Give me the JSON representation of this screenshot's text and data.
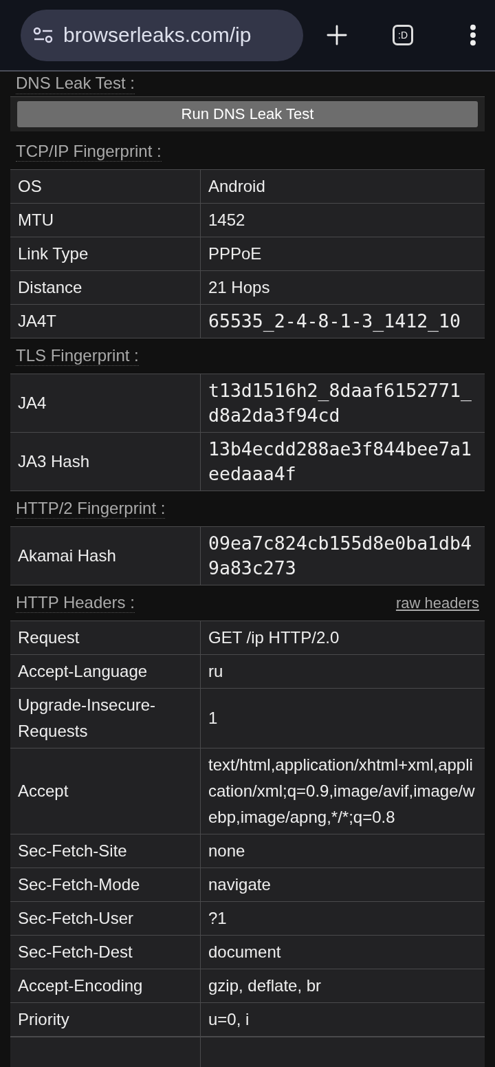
{
  "browser": {
    "url": "browserleaks.com/ip",
    "tab_count": ":D"
  },
  "sections": [
    {
      "title": "DNS Leak Test :",
      "button": "Run DNS Leak Test"
    },
    {
      "title": "TCP/IP Fingerprint :",
      "rows": [
        {
          "key": "OS",
          "value": "Android",
          "kind": "text"
        },
        {
          "key": "MTU",
          "value": "1452",
          "kind": "text"
        },
        {
          "key": "Link Type",
          "value": "PPPoE",
          "kind": "text"
        },
        {
          "key": "Distance",
          "value": "21 Hops",
          "kind": "text"
        },
        {
          "key": "JA4T",
          "value": "65535_2-4-8-1-3_1412_10",
          "kind": "mono"
        }
      ]
    },
    {
      "title": "TLS Fingerprint :",
      "rows": [
        {
          "key": "JA4",
          "value": "t13d1516h2_8daaf6152771_d8a2da3f94cd",
          "kind": "mono"
        },
        {
          "key": "JA3 Hash",
          "value": "13b4ecdd288ae3f844bee7a1eedaaa4f",
          "kind": "mono"
        }
      ]
    },
    {
      "title": "HTTP/2 Fingerprint :",
      "rows": [
        {
          "key": "Akamai Hash",
          "value": "09ea7c824cb155d8e0ba1db49a83c273",
          "kind": "mono"
        }
      ]
    },
    {
      "title": "HTTP Headers :",
      "link": "raw headers",
      "rows": [
        {
          "key": "Request",
          "value": "GET /ip HTTP/2.0",
          "kind": "text"
        },
        {
          "key": "Accept-Language",
          "value": "ru",
          "kind": "text"
        },
        {
          "key": "Upgrade-Insecure-Requests",
          "value": "1",
          "kind": "text"
        },
        {
          "key": "Accept",
          "value": "text/html,application/xhtml+xml,application/xml;q=0.9,image/avif,image/webp,image/apng,*/*;q=0.8",
          "kind": "text"
        },
        {
          "key": "Sec-Fetch-Site",
          "value": "none",
          "kind": "text"
        },
        {
          "key": "Sec-Fetch-Mode",
          "value": "navigate",
          "kind": "text"
        },
        {
          "key": "Sec-Fetch-User",
          "value": "?1",
          "kind": "text"
        },
        {
          "key": "Sec-Fetch-Dest",
          "value": "document",
          "kind": "text"
        },
        {
          "key": "Accept-Encoding",
          "value": "gzip, deflate, br",
          "kind": "text"
        },
        {
          "key": "Priority",
          "value": "u=0, i",
          "kind": "text"
        }
      ]
    }
  ]
}
